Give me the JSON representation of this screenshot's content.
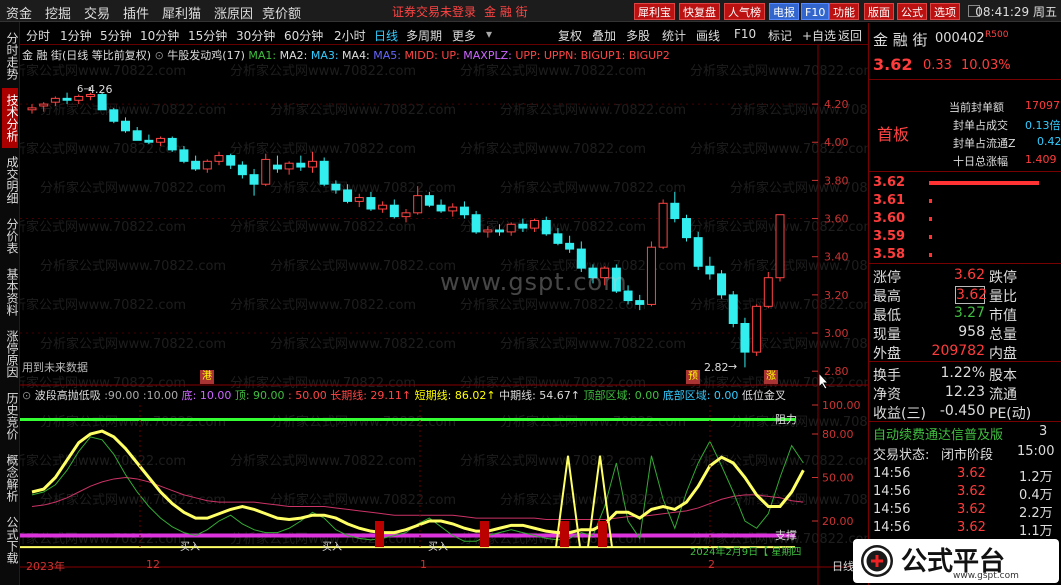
{
  "menu": [
    "资金",
    "挖掘",
    "交易",
    "插件",
    "犀利猫",
    "涨原因",
    "竞价额"
  ],
  "login_notice": "证券交易未登录",
  "menu_stock": "金 融 街",
  "toolbar_buttons": [
    "犀利宝",
    "快复盘",
    "人气榜",
    "电报",
    "F10",
    "功能",
    "版面",
    "公式",
    "选项"
  ],
  "clock": "08:41:29 周五",
  "left_tabs": [
    "分时走势",
    "技术分析",
    "成交明细",
    "分价表",
    "基本资料",
    "涨停原因",
    "历史竞价",
    "概念解析",
    "公式下载"
  ],
  "periods": [
    "分时",
    "1分钟",
    "5分钟",
    "10分钟",
    "15分钟",
    "30分钟",
    "60分钟",
    "2小时",
    "日线",
    "多周期",
    "更多"
  ],
  "period_selected": "日线",
  "period_tools": [
    "复权",
    "叠加",
    "多股",
    "统计",
    "画线",
    "F10",
    "标记",
    "+自选",
    "返回"
  ],
  "chart_legend": {
    "stock": "金 融 街(日线 等比前复权)",
    "indicator": "牛股发动鸡(17)",
    "items": [
      {
        "t": "MA1: ",
        "c": "#3fbf3f"
      },
      {
        "t": "MA2: ",
        "c": "#ddd"
      },
      {
        "t": "MA3: ",
        "c": "#3cf"
      },
      {
        "t": "MA4: ",
        "c": "#ddd"
      },
      {
        "t": "MA5: ",
        "c": "#66f"
      },
      {
        "t": "MIDD: ",
        "c": "#f44"
      },
      {
        "t": "UP: ",
        "c": "#f44"
      },
      {
        "t": "MAXPLZ: ",
        "c": "#c6f"
      },
      {
        "t": "UPP: ",
        "c": "#f44"
      },
      {
        "t": "UPPN: ",
        "c": "#f44"
      },
      {
        "t": "BIGUP1: ",
        "c": "#f44"
      },
      {
        "t": "BIGUP2",
        "c": "#f44"
      }
    ]
  },
  "ind_legend": {
    "name": "波段高抛低吸",
    "items": [
      {
        "t": ":90.00",
        "c": "#aaa"
      },
      {
        "t": ":10.00",
        "c": "#aaa"
      },
      {
        "t": "底: 10.00",
        "c": "#c6f"
      },
      {
        "t": "顶: 90.00",
        "c": "#3fbf3f"
      },
      {
        "t": ": 50.00",
        "c": "#f44"
      },
      {
        "t": "长期线: 29.11↑",
        "c": "#f44"
      },
      {
        "t": "短期线: 86.02↑",
        "c": "#ff0"
      },
      {
        "t": "中期线: 54.67↑",
        "c": "#ddd"
      },
      {
        "t": "顶部区域: 0.00",
        "c": "#3fbf3f"
      },
      {
        "t": "底部区域: 0.00",
        "c": "#3cf"
      },
      {
        "t": "低位金叉",
        "c": "#ddd"
      }
    ]
  },
  "watermark": "分析家公式网www.70822.com",
  "center_watermark": "www.gspt.com",
  "future_data_note": "用到未来数据",
  "price_labels": {
    "high": "4.26",
    "low": "2.82"
  },
  "event_marks": [
    "港",
    "预",
    "涨"
  ],
  "ind_annotations": {
    "resist": "阻力",
    "support": "支撑",
    "buy": "买入",
    "date_note": "2024年2月9日【 星期四"
  },
  "date_labels": [
    "2023年",
    "12",
    "1",
    "2"
  ],
  "axis_main": [
    "4.20",
    "4.00",
    "3.80",
    "3.60",
    "3.40",
    "3.20",
    "3.00",
    "2.80"
  ],
  "axis_ind": [
    "100.00",
    "80.00",
    "50.00",
    "20.00"
  ],
  "bottom_tab": "日线",
  "quote": {
    "name": "金 融 街",
    "code": "000402",
    "badge": "R500",
    "price": "3.62",
    "change": "0.33",
    "pct": "10.03%",
    "seal": [
      {
        "label": "当前封单额",
        "value": "17097"
      },
      {
        "label": "封单占成交",
        "value": "0.13倍"
      },
      {
        "label": "封单占流通Z",
        "value": "0.42"
      },
      {
        "label": "十日总涨幅",
        "value": "1.409"
      }
    ],
    "board_tag": "首板",
    "bids": [
      {
        "p": "3.62",
        "bar": 110
      },
      {
        "p": "3.61",
        "bar": 3
      },
      {
        "p": "3.60",
        "bar": 3
      },
      {
        "p": "3.59",
        "bar": 3
      },
      {
        "p": "3.58",
        "bar": 3
      }
    ],
    "stats": [
      {
        "l": "涨停",
        "v": "3.62",
        "c": "red",
        "r": "跌停"
      },
      {
        "l": "最高",
        "v": "3.62",
        "c": "red",
        "r": "量比",
        "boxed": true
      },
      {
        "l": "最低",
        "v": "3.27",
        "c": "green",
        "r": "市值"
      },
      {
        "l": "现量",
        "v": "958",
        "c": "white",
        "r": "总量"
      },
      {
        "l": "外盘",
        "v": "209782",
        "c": "red",
        "r": "内盘"
      }
    ],
    "stats2": [
      {
        "l": "换手",
        "v": "1.22%",
        "r": "股本"
      },
      {
        "l": "净资",
        "v": "12.23",
        "r": "流通"
      },
      {
        "l": "收益(三)",
        "v": "-0.450",
        "r": "PE(动)"
      }
    ],
    "news": "自动续费通达信普及版",
    "news_num": "3",
    "trade_status_label": "交易状态:",
    "trade_status": "闭市阶段",
    "trade_time": "15:00",
    "ticks": [
      {
        "t": "14:56",
        "p": "3.62",
        "v": "1.2万"
      },
      {
        "t": "14:56",
        "p": "3.62",
        "v": "0.4万"
      },
      {
        "t": "14:56",
        "p": "3.62",
        "v": "2.2万"
      },
      {
        "t": "14:56",
        "p": "3.62",
        "v": "1.1万"
      }
    ]
  },
  "logo_text": "公式平台",
  "logo_url": "www.gspt.com",
  "chart_data": {
    "type": "candlestick",
    "ohlc": [
      [
        4.17,
        4.2,
        4.15,
        4.18
      ],
      [
        4.19,
        4.21,
        4.16,
        4.2
      ],
      [
        4.21,
        4.24,
        4.19,
        4.23
      ],
      [
        4.23,
        4.26,
        4.2,
        4.22
      ],
      [
        4.22,
        4.25,
        4.2,
        4.24
      ],
      [
        4.24,
        4.26,
        4.22,
        4.25
      ],
      [
        4.25,
        4.26,
        4.18,
        4.17
      ],
      [
        4.17,
        4.18,
        4.1,
        4.11
      ],
      [
        4.11,
        4.13,
        4.05,
        4.06
      ],
      [
        4.06,
        4.08,
        4.02,
        4.01
      ],
      [
        4.01,
        4.04,
        3.99,
        4.0
      ],
      [
        4.0,
        4.03,
        3.98,
        4.02
      ],
      [
        4.02,
        4.03,
        3.95,
        3.96
      ],
      [
        3.96,
        3.98,
        3.89,
        3.9
      ],
      [
        3.9,
        3.93,
        3.85,
        3.86
      ],
      [
        3.86,
        3.91,
        3.84,
        3.9
      ],
      [
        3.9,
        3.95,
        3.88,
        3.93
      ],
      [
        3.93,
        3.94,
        3.86,
        3.88
      ],
      [
        3.88,
        3.9,
        3.81,
        3.83
      ],
      [
        3.83,
        3.86,
        3.72,
        3.78
      ],
      [
        3.78,
        3.94,
        3.77,
        3.91
      ],
      [
        3.88,
        3.93,
        3.84,
        3.86
      ],
      [
        3.86,
        3.9,
        3.83,
        3.89
      ],
      [
        3.89,
        3.93,
        3.85,
        3.87
      ],
      [
        3.87,
        3.95,
        3.84,
        3.9
      ],
      [
        3.9,
        3.92,
        3.77,
        3.78
      ],
      [
        3.78,
        3.8,
        3.73,
        3.75
      ],
      [
        3.75,
        3.78,
        3.68,
        3.69
      ],
      [
        3.69,
        3.73,
        3.66,
        3.71
      ],
      [
        3.71,
        3.74,
        3.64,
        3.65
      ],
      [
        3.65,
        3.69,
        3.63,
        3.67
      ],
      [
        3.67,
        3.7,
        3.6,
        3.61
      ],
      [
        3.61,
        3.65,
        3.58,
        3.63
      ],
      [
        3.63,
        3.77,
        3.62,
        3.72
      ],
      [
        3.72,
        3.74,
        3.66,
        3.67
      ],
      [
        3.67,
        3.7,
        3.63,
        3.64
      ],
      [
        3.64,
        3.68,
        3.61,
        3.66
      ],
      [
        3.66,
        3.69,
        3.6,
        3.62
      ],
      [
        3.62,
        3.64,
        3.52,
        3.53
      ],
      [
        3.53,
        3.56,
        3.5,
        3.54
      ],
      [
        3.54,
        3.57,
        3.51,
        3.53
      ],
      [
        3.53,
        3.58,
        3.51,
        3.57
      ],
      [
        3.57,
        3.6,
        3.53,
        3.55
      ],
      [
        3.55,
        3.6,
        3.53,
        3.59
      ],
      [
        3.59,
        3.61,
        3.51,
        3.52
      ],
      [
        3.52,
        3.55,
        3.46,
        3.47
      ],
      [
        3.47,
        3.51,
        3.42,
        3.44
      ],
      [
        3.44,
        3.48,
        3.32,
        3.34
      ],
      [
        3.34,
        3.36,
        3.26,
        3.29
      ],
      [
        3.29,
        3.35,
        3.25,
        3.34
      ],
      [
        3.34,
        3.36,
        3.21,
        3.22
      ],
      [
        3.22,
        3.25,
        3.15,
        3.17
      ],
      [
        3.17,
        3.2,
        3.12,
        3.15
      ],
      [
        3.15,
        3.48,
        3.14,
        3.45
      ],
      [
        3.45,
        3.7,
        3.44,
        3.68
      ],
      [
        3.68,
        3.74,
        3.58,
        3.6
      ],
      [
        3.6,
        3.62,
        3.48,
        3.5
      ],
      [
        3.5,
        3.53,
        3.33,
        3.35
      ],
      [
        3.35,
        3.4,
        3.28,
        3.31
      ],
      [
        3.31,
        3.33,
        3.18,
        3.2
      ],
      [
        3.2,
        3.22,
        3.03,
        3.05
      ],
      [
        3.05,
        3.08,
        2.82,
        2.9
      ],
      [
        2.9,
        3.15,
        2.88,
        3.14
      ],
      [
        3.14,
        3.32,
        3.13,
        3.29
      ],
      [
        3.29,
        3.62,
        3.27,
        3.62
      ]
    ],
    "price_range": [
      2.78,
      4.3
    ],
    "ind_range": [
      0,
      100
    ],
    "short_line": [
      38,
      40,
      45,
      55,
      68,
      78,
      76,
      66,
      52,
      40,
      30,
      22,
      16,
      12,
      10,
      14,
      20,
      24,
      18,
      14,
      12,
      12,
      15,
      20,
      26,
      22,
      14,
      10,
      8,
      7,
      8,
      10,
      12,
      18,
      22,
      16,
      10,
      6,
      6,
      10,
      12,
      14,
      12,
      10,
      8,
      7,
      8,
      12,
      10,
      30,
      60,
      20,
      8,
      65,
      35,
      15,
      40,
      60,
      75,
      58,
      40,
      20,
      15,
      25,
      50,
      72,
      60
    ],
    "mid_line": [
      40,
      42,
      50,
      62,
      74,
      80,
      82,
      78,
      70,
      60,
      50,
      40,
      32,
      26,
      22,
      22,
      25,
      28,
      30,
      28,
      25,
      22,
      21,
      22,
      24,
      24,
      22,
      18,
      15,
      13,
      12,
      12,
      14,
      17,
      20,
      20,
      18,
      15,
      13,
      13,
      15,
      17,
      17,
      15,
      13,
      12,
      12,
      14,
      14,
      18,
      26,
      26,
      22,
      28,
      30,
      28,
      33,
      44,
      58,
      64,
      60,
      50,
      38,
      30,
      30,
      40,
      55
    ],
    "long_line": [
      30,
      31,
      33,
      36,
      40,
      44,
      47,
      49,
      50,
      49,
      47,
      44,
      41,
      38,
      36,
      34,
      33,
      33,
      33,
      33,
      32,
      31,
      30,
      30,
      30,
      30,
      29,
      28,
      27,
      26,
      25,
      24,
      24,
      24,
      24,
      24,
      24,
      23,
      22,
      22,
      22,
      22,
      22,
      22,
      21,
      21,
      21,
      21,
      21,
      21,
      22,
      23,
      23,
      24,
      25,
      26,
      27,
      29,
      32,
      35,
      37,
      38,
      38,
      37,
      36,
      34,
      33
    ]
  }
}
